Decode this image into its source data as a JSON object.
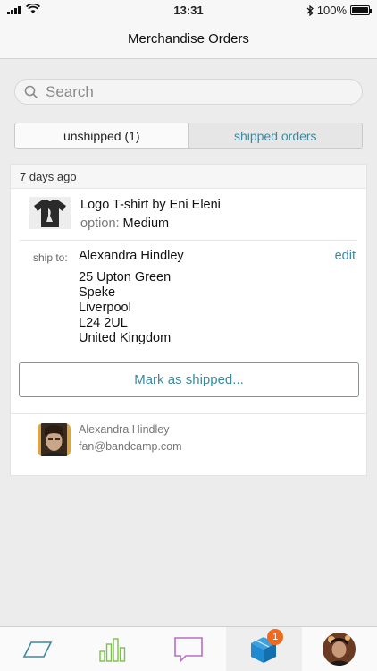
{
  "status": {
    "time": "13:31",
    "battery": "100%",
    "battery_level": 1.0
  },
  "nav": {
    "title": "Merchandise Orders"
  },
  "search": {
    "placeholder": "Search"
  },
  "tabs": {
    "unshipped": "unshipped (1)",
    "shipped": "shipped orders"
  },
  "order": {
    "age": "7 days ago",
    "item_title": "Logo T-shirt by Eni Eleni",
    "option_label": "option:",
    "option_value": "Medium",
    "ship_label": "ship to:",
    "ship_name": "Alexandra Hindley",
    "edit_label": "edit",
    "address": [
      "25 Upton Green",
      "Speke",
      "Liverpool",
      "L24 2UL",
      "United Kingdom"
    ],
    "mark_shipped_label": "Mark as shipped...",
    "buyer_name": "Alexandra Hindley",
    "buyer_email": "fan@bandcamp.com"
  },
  "tab_bar": {
    "items": [
      {
        "icon": "parallelogram-icon",
        "color": "#3c8aa0"
      },
      {
        "icon": "bar-chart-icon",
        "color": "#7cc04a"
      },
      {
        "icon": "message-icon",
        "color": "#b96cc8"
      },
      {
        "icon": "box-icon",
        "color": "#1f8ad1",
        "badge": "1"
      },
      {
        "icon": "profile-avatar"
      }
    ]
  },
  "colors": {
    "accent": "#3c8aa0",
    "badge": "#f06a1d"
  }
}
